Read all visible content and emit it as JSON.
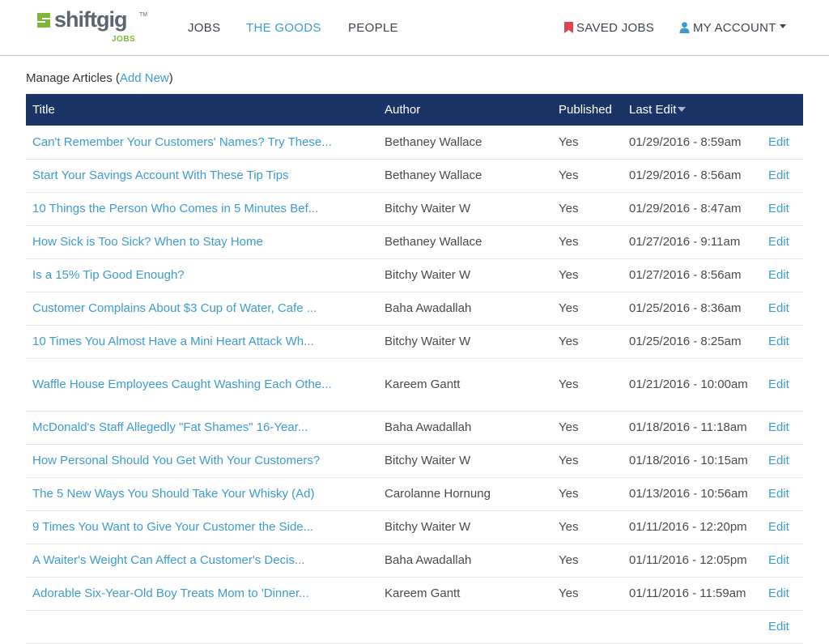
{
  "brand": {
    "name": "shiftgig",
    "tm": "TM",
    "sub": "JOBS",
    "color_green": "#7fb539",
    "color_gray": "#5c6670"
  },
  "nav": {
    "jobs": "JOBS",
    "goods": "THE GOODS",
    "people": "PEOPLE",
    "saved_jobs": "SAVED JOBS",
    "my_account": "MY ACCOUNT",
    "active": "THE GOODS",
    "accent_color": "#3d9bd1",
    "saved_icon": "bookmark-icon",
    "account_icon": "user-icon"
  },
  "page": {
    "title_prefix": "Manage Articles (",
    "add_new": "Add New",
    "title_suffix": ")"
  },
  "table": {
    "header_bg": "#1b3466",
    "columns": {
      "title": "Title",
      "author": "Author",
      "published": "Published",
      "last_edit": "Last Edit"
    },
    "sorted_by": "Last Edit",
    "rows": [
      {
        "title": "Can't Remember Your Customers' Names? Try These...",
        "author": "Bethaney Wallace",
        "published": "Yes",
        "last_edit": "01/29/2016 - 8:59am",
        "action": "Edit"
      },
      {
        "title": "Start Your Savings Account With These Tip Tips",
        "author": "Bethaney Wallace",
        "published": "Yes",
        "last_edit": "01/29/2016 - 8:56am",
        "action": "Edit"
      },
      {
        "title": "10 Things the Person Who Comes in 5 Minutes Bef...",
        "author": "Bitchy Waiter W",
        "published": "Yes",
        "last_edit": "01/29/2016 - 8:47am",
        "action": "Edit"
      },
      {
        "title": "How Sick is Too Sick? When to Stay Home",
        "author": "Bethaney Wallace",
        "published": "Yes",
        "last_edit": "01/27/2016 - 9:11am",
        "action": "Edit"
      },
      {
        "title": "Is a 15% Tip Good Enough?",
        "author": "Bitchy Waiter W",
        "published": "Yes",
        "last_edit": "01/27/2016 - 8:56am",
        "action": "Edit"
      },
      {
        "title": "Customer Complains About $3 Cup of Water, Cafe ...",
        "author": "Baha Awadallah",
        "published": "Yes",
        "last_edit": "01/25/2016 - 8:36am",
        "action": "Edit"
      },
      {
        "title": "10 Times You Almost Have a Mini Heart Attack Wh...",
        "author": "Bitchy Waiter W",
        "published": "Yes",
        "last_edit": "01/25/2016 - 8:25am",
        "action": "Edit"
      },
      {
        "title": "Waffle House Employees Caught Washing Each Othe...",
        "author": "Kareem Gantt",
        "published": "Yes",
        "last_edit": "01/21/2016 - 10:00am",
        "action": "Edit"
      },
      {
        "title": "McDonald's Staff Allegedly \"Fat Shames\" 16-Year...",
        "author": "Baha Awadallah",
        "published": "Yes",
        "last_edit": "01/18/2016 - 11:18am",
        "action": "Edit"
      },
      {
        "title": "How Personal Should You Get With Your Customers?",
        "author": "Bitchy Waiter W",
        "published": "Yes",
        "last_edit": "01/18/2016 - 10:15am",
        "action": "Edit"
      },
      {
        "title": "The 5 New Ways You Should Take Your Whisky (Ad)",
        "author": "Carolanne Hornung",
        "published": "Yes",
        "last_edit": "01/13/2016 - 10:56am",
        "action": "Edit"
      },
      {
        "title": "9 Times You Want to Give Your Customer the Side...",
        "author": "Bitchy Waiter W",
        "published": "Yes",
        "last_edit": "01/11/2016 - 12:20pm",
        "action": "Edit"
      },
      {
        "title": "A Waiter's Weight Can Affect a Customer's Decis...",
        "author": "Baha Awadallah",
        "published": "Yes",
        "last_edit": "01/11/2016 - 12:05pm",
        "action": "Edit"
      },
      {
        "title": "Adorable Six-Year-Old Boy Treats Mom to 'Dinner...",
        "author": "Kareem Gantt",
        "published": "Yes",
        "last_edit": "01/11/2016 - 11:59am",
        "action": "Edit"
      },
      {
        "title": "",
        "author": "",
        "published": "",
        "last_edit": "",
        "action": "Edit"
      }
    ]
  }
}
